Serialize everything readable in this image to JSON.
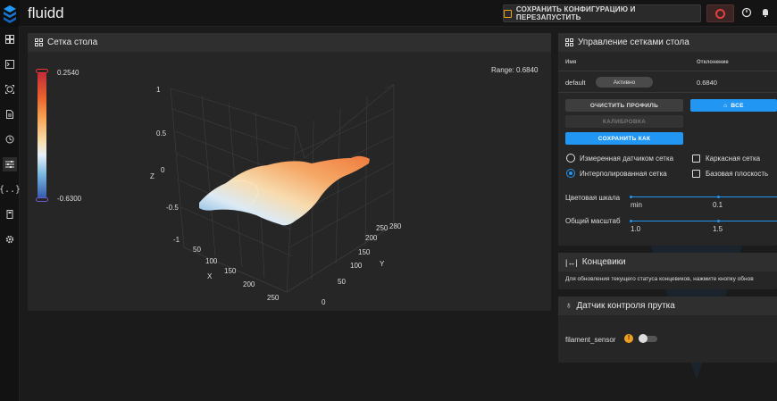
{
  "app": {
    "title": "fluidd"
  },
  "topbar": {
    "save_label": "СОХРАНИТЬ КОНФИГУРАЦИЮ И ПЕРЕЗАПУСТИТЬ"
  },
  "nav": {
    "icons": [
      "dashboard-icon",
      "console-icon",
      "webcam-icon",
      "files-icon",
      "history-icon",
      "tune-icon",
      "macros-icon",
      "system-icon",
      "settings-icon"
    ]
  },
  "mesh_card": {
    "title": "Сетка стола",
    "range_label": "Range: 0.6840",
    "scale_max": "0.2540",
    "scale_min": "-0.6300",
    "axis_z": "Z",
    "axis_x": "X",
    "axis_y": "Y",
    "z_ticks": [
      "1",
      "0.5",
      "0",
      "-0.5",
      "-1"
    ],
    "x_ticks": [
      "50",
      "100",
      "150",
      "200",
      "250"
    ],
    "y_ticks": [
      "0",
      "50",
      "100",
      "150",
      "200",
      "250",
      "280"
    ]
  },
  "mesh_panel": {
    "title": "Управление сетками стола",
    "col_name": "Имя",
    "col_dev": "Отклонение",
    "profile_name": "default",
    "profile_badge": "Активно",
    "profile_dev": "0.6840",
    "clear_label": "ОЧИСТИТЬ ПРОФИЛЬ",
    "home_label": "ВСЕ",
    "calibrate_label": "КАЛИБРОВКА",
    "save_as_label": "СОХРАНИТЬ КАК",
    "opt_measured": "Измеренная датчиком сетка",
    "opt_interp": "Интерполированная сетка",
    "opt_wire": "Каркасная сетка",
    "opt_flat": "Базовая плоскость",
    "color_scale_label": "Цветовая шкала",
    "color_min": "min",
    "color_val": "0.1",
    "scale_label": "Общий масштаб",
    "scale_min": "1.0",
    "scale_val": "1.5"
  },
  "endstops": {
    "title": "Концевики",
    "hint": "Для обновления текущего статуса концевиков, нажмите кнопку обнов"
  },
  "filament": {
    "title": "Датчик контроля прутка",
    "sensor_name": "filament_sensor"
  },
  "colors": {
    "accent": "#2196f3",
    "warning": "#f0a020",
    "danger": "#e34040"
  }
}
